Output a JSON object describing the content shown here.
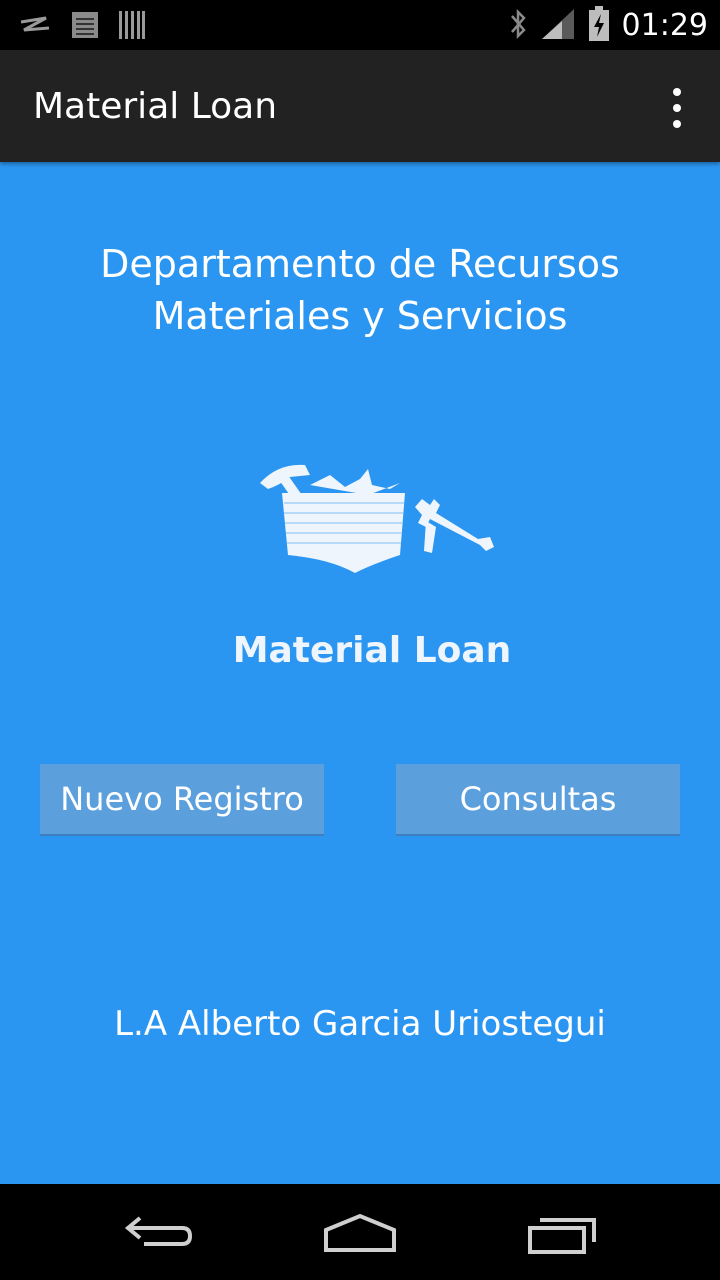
{
  "status_bar": {
    "time": "01:29",
    "left_icons": [
      "notification-icon",
      "document-icon",
      "barcode-icon"
    ],
    "right_icons": [
      "bluetooth-icon",
      "signal-icon",
      "battery-charging-icon"
    ]
  },
  "action_bar": {
    "title": "Material Loan",
    "menu_icon": "overflow-menu-icon"
  },
  "main": {
    "department_line1": "Departamento de Recursos",
    "department_line2": "Materiales y Servicios",
    "logo_text": "Material Loan",
    "new_record_label": "Nuevo Registro",
    "queries_label": "Consultas",
    "author": "L.A Alberto Garcia Uriostegui"
  },
  "nav_bar": {
    "icons": [
      "back-icon",
      "home-icon",
      "recent-apps-icon"
    ]
  },
  "colors": {
    "background": "#2b96f2",
    "action_bar": "#222222",
    "button": "#5b9fdd",
    "system_bars": "#000000"
  }
}
